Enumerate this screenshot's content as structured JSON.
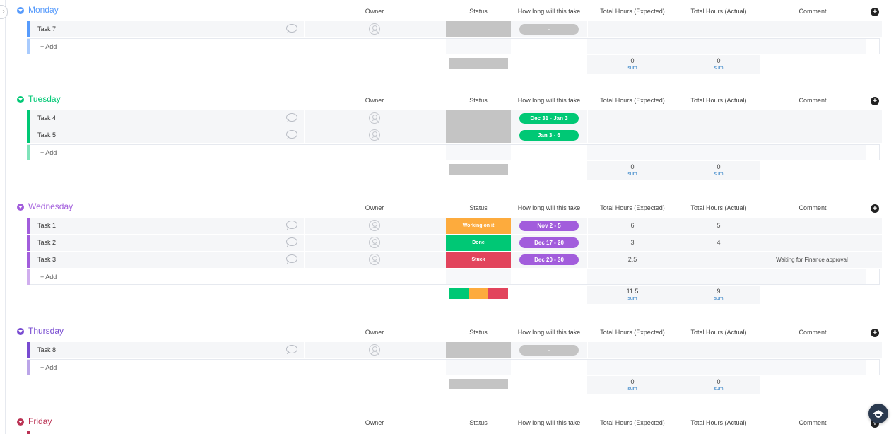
{
  "columns": {
    "owner": "Owner",
    "status": "Status",
    "how_long": "How long will this take",
    "expected": "Total Hours (Expected)",
    "actual": "Total Hours (Actual)",
    "comment": "Comment"
  },
  "add_label": "+ Add",
  "sum_label": "sum",
  "groups": [
    {
      "title": "Monday",
      "color": "#579bfc",
      "light": "#a9cbfd",
      "tasks": [
        {
          "name": "Task 7",
          "status": "",
          "status_color": "#c4c4c4",
          "timeline": "-",
          "timeline_color": "#c4c4c4",
          "expected": "",
          "actual": "",
          "comment": ""
        }
      ],
      "sum_expected": "0",
      "sum_actual": "0",
      "summary_bar": [
        {
          "color": "#c4c4c4",
          "fraction": 1
        }
      ]
    },
    {
      "title": "Tuesday",
      "color": "#00c875",
      "light": "#80e3ba",
      "tasks": [
        {
          "name": "Task 4",
          "status": "",
          "status_color": "#c4c4c4",
          "timeline": "Dec 31 - Jan 3",
          "timeline_color": "#00c875",
          "expected": "",
          "actual": "",
          "comment": ""
        },
        {
          "name": "Task 5",
          "status": "",
          "status_color": "#c4c4c4",
          "timeline": "Jan 3 - 6",
          "timeline_color": "#00c875",
          "expected": "",
          "actual": "",
          "comment": ""
        }
      ],
      "sum_expected": "0",
      "sum_actual": "0",
      "summary_bar": [
        {
          "color": "#c4c4c4",
          "fraction": 1
        }
      ]
    },
    {
      "title": "Wednesday",
      "color": "#a25ddc",
      "light": "#d0aeee",
      "tasks": [
        {
          "name": "Task 1",
          "status": "Working on it",
          "status_color": "#fdab3d",
          "timeline": "Nov 2 - 5",
          "timeline_color": "#a25ddc",
          "expected": "6",
          "actual": "5",
          "comment": ""
        },
        {
          "name": "Task 2",
          "status": "Done",
          "status_color": "#00c875",
          "timeline": "Dec 17 - 20",
          "timeline_color": "#a25ddc",
          "expected": "3",
          "actual": "4",
          "comment": ""
        },
        {
          "name": "Task 3",
          "status": "Stuck",
          "status_color": "#e2445c",
          "timeline": "Dec 20 - 30",
          "timeline_color": "#a25ddc",
          "expected": "2.5",
          "actual": "",
          "comment": "Waiting for Finance approval"
        }
      ],
      "sum_expected": "11.5",
      "sum_actual": "9",
      "summary_bar": [
        {
          "color": "#00c875",
          "fraction": 0.333
        },
        {
          "color": "#fdab3d",
          "fraction": 0.333
        },
        {
          "color": "#e2445c",
          "fraction": 0.334
        }
      ]
    },
    {
      "title": "Thursday",
      "color": "#784bd1",
      "light": "#bba5e8",
      "tasks": [
        {
          "name": "Task 8",
          "status": "",
          "status_color": "#c4c4c4",
          "timeline": "-",
          "timeline_color": "#c4c4c4",
          "expected": "",
          "actual": "",
          "comment": ""
        }
      ],
      "sum_expected": "0",
      "sum_actual": "0",
      "summary_bar": [
        {
          "color": "#c4c4c4",
          "fraction": 1
        }
      ]
    },
    {
      "title": "Friday",
      "color": "#bb3354",
      "light": "#dd99a9",
      "tasks": [],
      "sum_expected": "",
      "sum_actual": "",
      "summary_bar": []
    }
  ]
}
